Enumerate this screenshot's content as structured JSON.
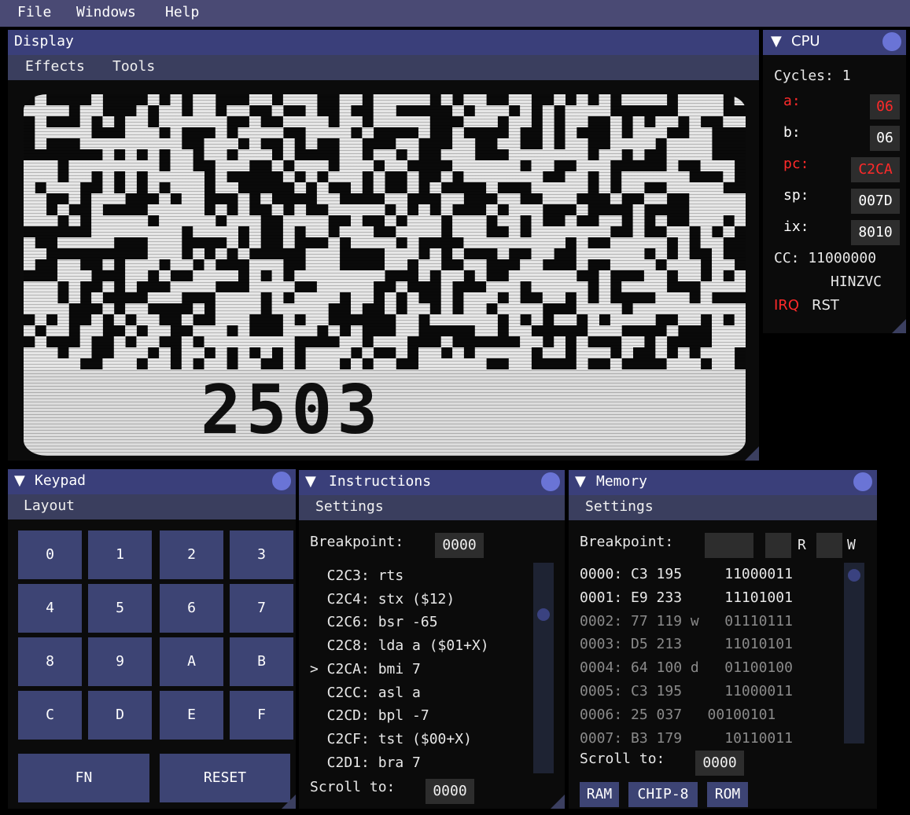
{
  "menu": {
    "file": "File",
    "windows": "Windows",
    "help": "Help"
  },
  "display": {
    "title": "Display",
    "menu": [
      "Effects",
      "Tools"
    ],
    "score": "2503"
  },
  "cpu": {
    "title": "CPU",
    "cycles_label": "Cycles: 1",
    "registers": [
      {
        "label": "a:",
        "value": "06",
        "label_color": "#ff2a2a",
        "value_color": "#ff2a2a"
      },
      {
        "label": "b:",
        "value": "06",
        "label_color": "#ffffff",
        "value_color": "#ffffff"
      },
      {
        "label": "pc:",
        "value": "C2CA",
        "label_color": "#ff2a2a",
        "value_color": "#ff2a2a"
      },
      {
        "label": "sp:",
        "value": "007D",
        "label_color": "#ffffff",
        "value_color": "#ffffff"
      },
      {
        "label": "ix:",
        "value": "8010",
        "label_color": "#ffffff",
        "value_color": "#ffffff"
      }
    ],
    "cc": "CC: 11000000",
    "flags": "HINZVC",
    "irq": "IRQ",
    "rst": "RST"
  },
  "keypad": {
    "title": "Keypad",
    "menu": "Layout",
    "keys": [
      "0",
      "1",
      "2",
      "3",
      "4",
      "5",
      "6",
      "7",
      "8",
      "9",
      "A",
      "B",
      "C",
      "D",
      "E",
      "F"
    ],
    "fn": "FN",
    "reset": "RESET"
  },
  "instructions": {
    "title": "Instructions",
    "menu": "Settings",
    "breakpoint_label": "Breakpoint:",
    "breakpoint_value": "0000",
    "lines": [
      "  C2C3: rts",
      "  C2C4: stx ($12)",
      "  C2C6: bsr -65",
      "  C2C8: lda a ($01+X)",
      "> C2CA: bmi 7",
      "  C2CC: asl a",
      "  C2CD: bpl -7",
      "  C2CF: tst ($00+X)",
      "  C2D1: bra 7"
    ],
    "scroll_label": "Scroll to:",
    "scroll_value": "0000"
  },
  "memory": {
    "title": "Memory",
    "menu": "Settings",
    "breakpoint_label": "Breakpoint:",
    "r_label": "R",
    "w_label": "W",
    "rows": [
      {
        "text": "0000: C3 195     11000011",
        "dim": false
      },
      {
        "text": "0001: E9 233     11101001",
        "dim": false
      },
      {
        "text": "0002: 77 119 w   01110111",
        "dim": true
      },
      {
        "text": "0003: D5 213     11010101",
        "dim": true
      },
      {
        "text": "0004: 64 100 d   01100100",
        "dim": true
      },
      {
        "text": "0005: C3 195     11000011",
        "dim": true
      },
      {
        "text": "0006: 25 037   00100101",
        "dim": true
      },
      {
        "text": "0007: B3 179     10110011",
        "dim": true
      }
    ],
    "scroll_label": "Scroll to:",
    "scroll_value": "0000",
    "buttons": [
      "RAM",
      "CHIP-8",
      "ROM"
    ]
  }
}
